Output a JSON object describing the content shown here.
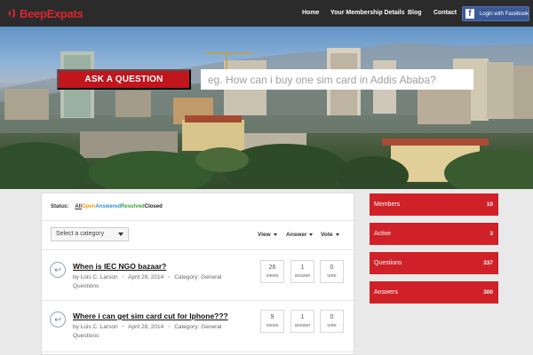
{
  "brand": {
    "name": "BeepExpats"
  },
  "nav": {
    "items": [
      "Home",
      "Your Membership Details",
      "Blog",
      "Contact"
    ]
  },
  "facebook": {
    "label": "Login with Facebook",
    "icon": "facebook-icon"
  },
  "hero": {
    "ask_button": "ASK A QUESTION",
    "search_placeholder": "eg. How can i buy one sim card in Addis Ababa?"
  },
  "filters": {
    "status_label": "Status:",
    "statuses": [
      "All",
      "Open",
      "Answered",
      "Resolved",
      "Closed"
    ],
    "category_placeholder": "Select a category",
    "sort": [
      "View",
      "Answer",
      "Vote"
    ]
  },
  "questions": [
    {
      "title": "When is IEC NGO bazaar?",
      "by": "by",
      "author": "Lois C. Larson",
      "date": "April 28, 2014",
      "category_label": "Category:",
      "category": "General Questions",
      "views": "26",
      "views_label": "views",
      "answers": "1",
      "answers_label": "answer",
      "votes": "0",
      "votes_label": "vote"
    },
    {
      "title": "Where i can get sim card cut for Iphone???",
      "by": "by",
      "author": "Lois C. Larson",
      "date": "April 28, 2014",
      "category_label": "Category:",
      "category": "General Questions",
      "views": "9",
      "views_label": "views",
      "answers": "1",
      "answers_label": "answer",
      "votes": "0",
      "votes_label": "vote"
    }
  ],
  "stats": [
    {
      "label": "Members",
      "value": "10"
    },
    {
      "label": "Active",
      "value": "3"
    },
    {
      "label": "Questions",
      "value": "337"
    },
    {
      "label": "Answers",
      "value": "300"
    }
  ],
  "colors": {
    "brand_red": "#cf2127",
    "header_bg": "#2b2b2b",
    "facebook_blue": "#3b5998"
  }
}
